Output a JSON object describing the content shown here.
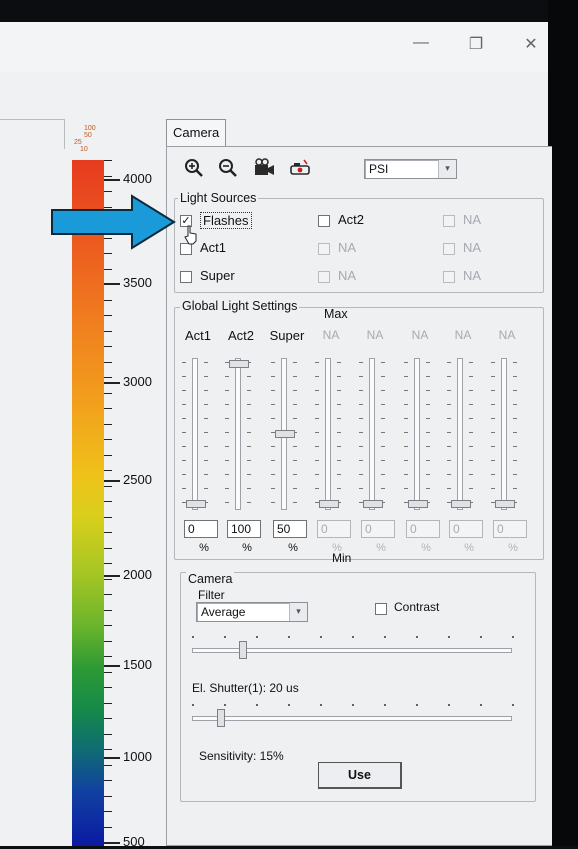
{
  "window": {
    "minimize_glyph": "—",
    "restore_glyph": "❐",
    "close_glyph": "✕"
  },
  "scale": {
    "top_labels": [
      "100",
      "50",
      "25",
      "10"
    ],
    "ticks": [
      "4000",
      "3500",
      "3000",
      "2500",
      "2000",
      "1500",
      "1000",
      "500"
    ]
  },
  "tab": {
    "label": "Camera"
  },
  "toolbar": {
    "icons": [
      "zoom-in-icon",
      "zoom-out-icon",
      "camera-icon",
      "flash-icon"
    ],
    "preset_value": "PSI"
  },
  "light_sources": {
    "title": "Light Sources",
    "items": [
      {
        "label": "Flashes",
        "checked": true,
        "enabled": true
      },
      {
        "label": "Act2",
        "checked": false,
        "enabled": true
      },
      {
        "label": "NA",
        "checked": false,
        "enabled": false
      },
      {
        "label": "Act1",
        "checked": false,
        "enabled": true
      },
      {
        "label": "NA",
        "checked": false,
        "enabled": false
      },
      {
        "label": "NA",
        "checked": false,
        "enabled": false
      },
      {
        "label": "Super",
        "checked": false,
        "enabled": true
      },
      {
        "label": "NA",
        "checked": false,
        "enabled": false
      },
      {
        "label": "NA",
        "checked": false,
        "enabled": false
      }
    ]
  },
  "global_light": {
    "title": "Global Light Settings",
    "max_label": "Max",
    "min_label": "Min",
    "channels": [
      {
        "label": "Act1",
        "value": "0",
        "unit": "%",
        "level": 0,
        "enabled": true
      },
      {
        "label": "Act2",
        "value": "100",
        "unit": "%",
        "level": 100,
        "enabled": true
      },
      {
        "label": "Super",
        "value": "50",
        "unit": "%",
        "level": 50,
        "enabled": true
      },
      {
        "label": "NA",
        "value": "0",
        "unit": "%",
        "level": 0,
        "enabled": false
      },
      {
        "label": "NA",
        "value": "0",
        "unit": "%",
        "level": 0,
        "enabled": false
      },
      {
        "label": "NA",
        "value": "0",
        "unit": "%",
        "level": 0,
        "enabled": false
      },
      {
        "label": "NA",
        "value": "0",
        "unit": "%",
        "level": 0,
        "enabled": false
      },
      {
        "label": "NA",
        "value": "0",
        "unit": "%",
        "level": 0,
        "enabled": false
      }
    ]
  },
  "camera": {
    "title": "Camera",
    "filter_label": "Filter",
    "filter_value": "Average",
    "contrast_label": "Contrast",
    "contrast_checked": false,
    "shutter_label": "El. Shutter(1): 20 us",
    "shutter_level": 0.08,
    "sensitivity_label": "Sensitivity: 15%",
    "sensitivity_level": 0.15,
    "use_button": "Use"
  }
}
